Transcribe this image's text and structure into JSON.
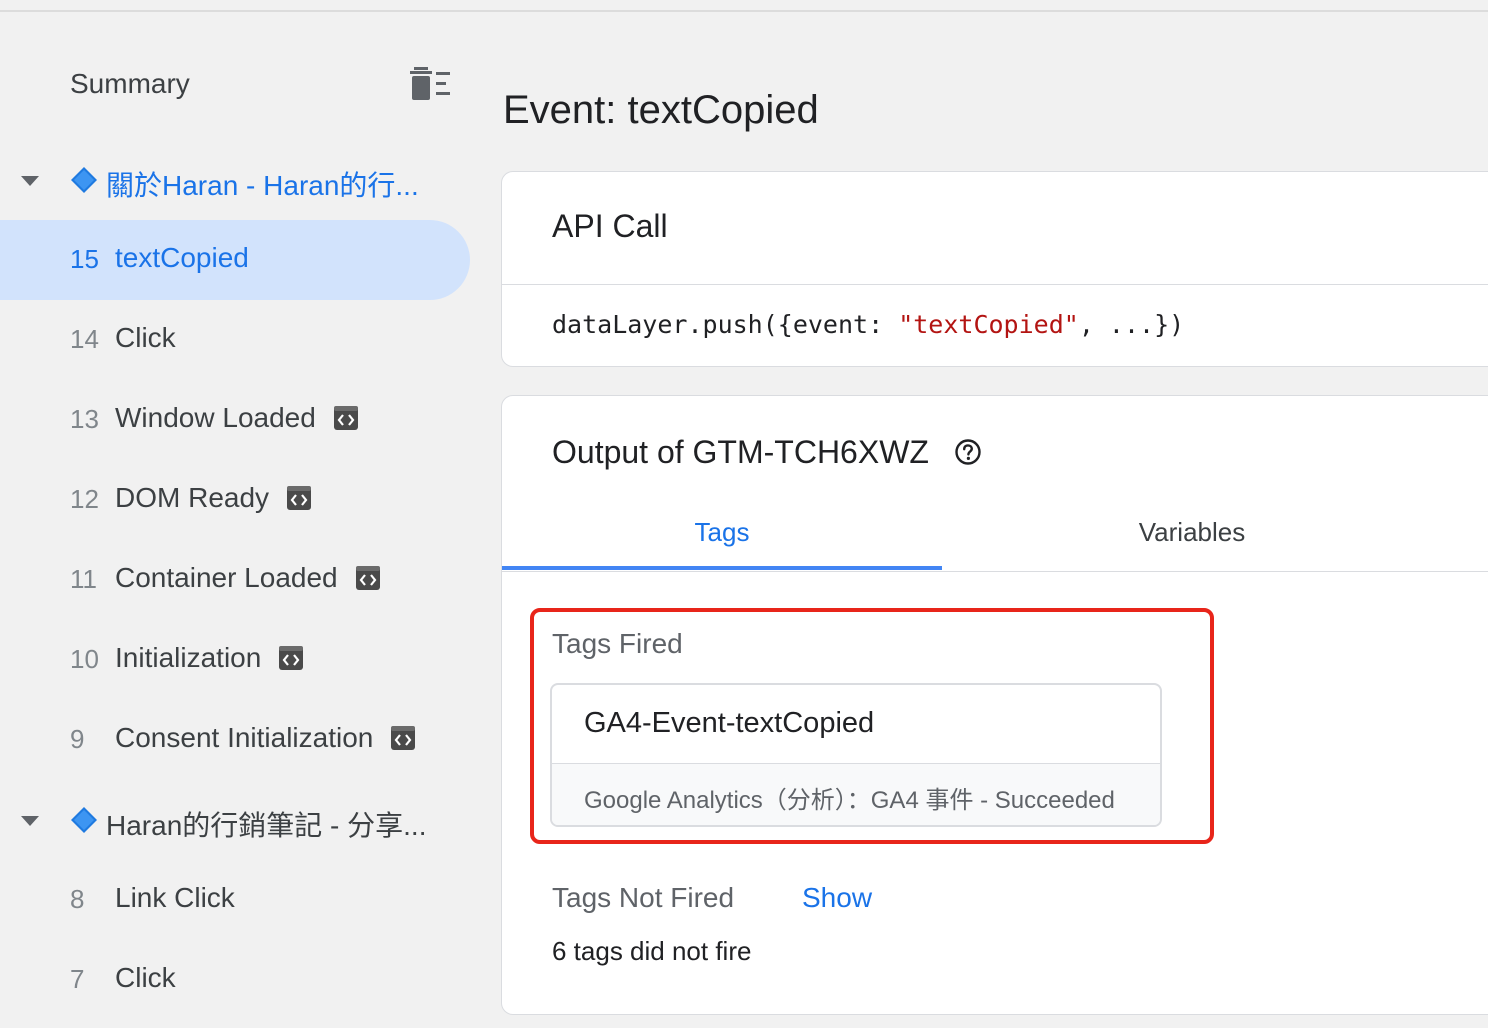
{
  "sidebar": {
    "summary_label": "Summary",
    "groups": [
      {
        "label": "關於Haran - Haran的行...",
        "events": [
          {
            "num": "15",
            "label": "textCopied",
            "selected": true
          },
          {
            "num": "14",
            "label": "Click"
          },
          {
            "num": "13",
            "label": "Window Loaded"
          },
          {
            "num": "12",
            "label": "DOM Ready"
          },
          {
            "num": "11",
            "label": "Container Loaded"
          },
          {
            "num": "10",
            "label": "Initialization"
          },
          {
            "num": "9",
            "label": "Consent Initialization"
          }
        ]
      },
      {
        "label": "Haran的行銷筆記 - 分享...",
        "events": [
          {
            "num": "8",
            "label": "Link Click"
          },
          {
            "num": "7",
            "label": "Click"
          }
        ]
      }
    ]
  },
  "main": {
    "event_title": "Event: textCopied",
    "api_call": {
      "title": "API Call",
      "code_prefix": "dataLayer.push({event: ",
      "code_string": "\"textCopied\"",
      "code_suffix": ", ...})"
    },
    "output": {
      "title": "Output of GTM-TCH6XWZ",
      "tabs": [
        {
          "label": "Tags"
        },
        {
          "label": "Variables"
        }
      ],
      "tags_fired_label": "Tags Fired",
      "fired_tag": {
        "name": "GA4-Event-textCopied",
        "status": "Google Analytics（分析）：GA4 事件 - Succeeded"
      },
      "tags_not_fired_label": "Tags Not Fired",
      "show_link": "Show",
      "not_fired_count": "6 tags did not fire"
    }
  },
  "colors": {
    "accent": "#1a73e8",
    "selected_bg": "#d2e3fc",
    "highlight_border": "#e8251a",
    "code_string": "#b31412"
  },
  "icons": {
    "summary_action": "delete-list-icon",
    "group_marker": "blue-diamond-icon",
    "event_type_marker": "code-brackets-icon",
    "help": "help-circle-icon"
  }
}
